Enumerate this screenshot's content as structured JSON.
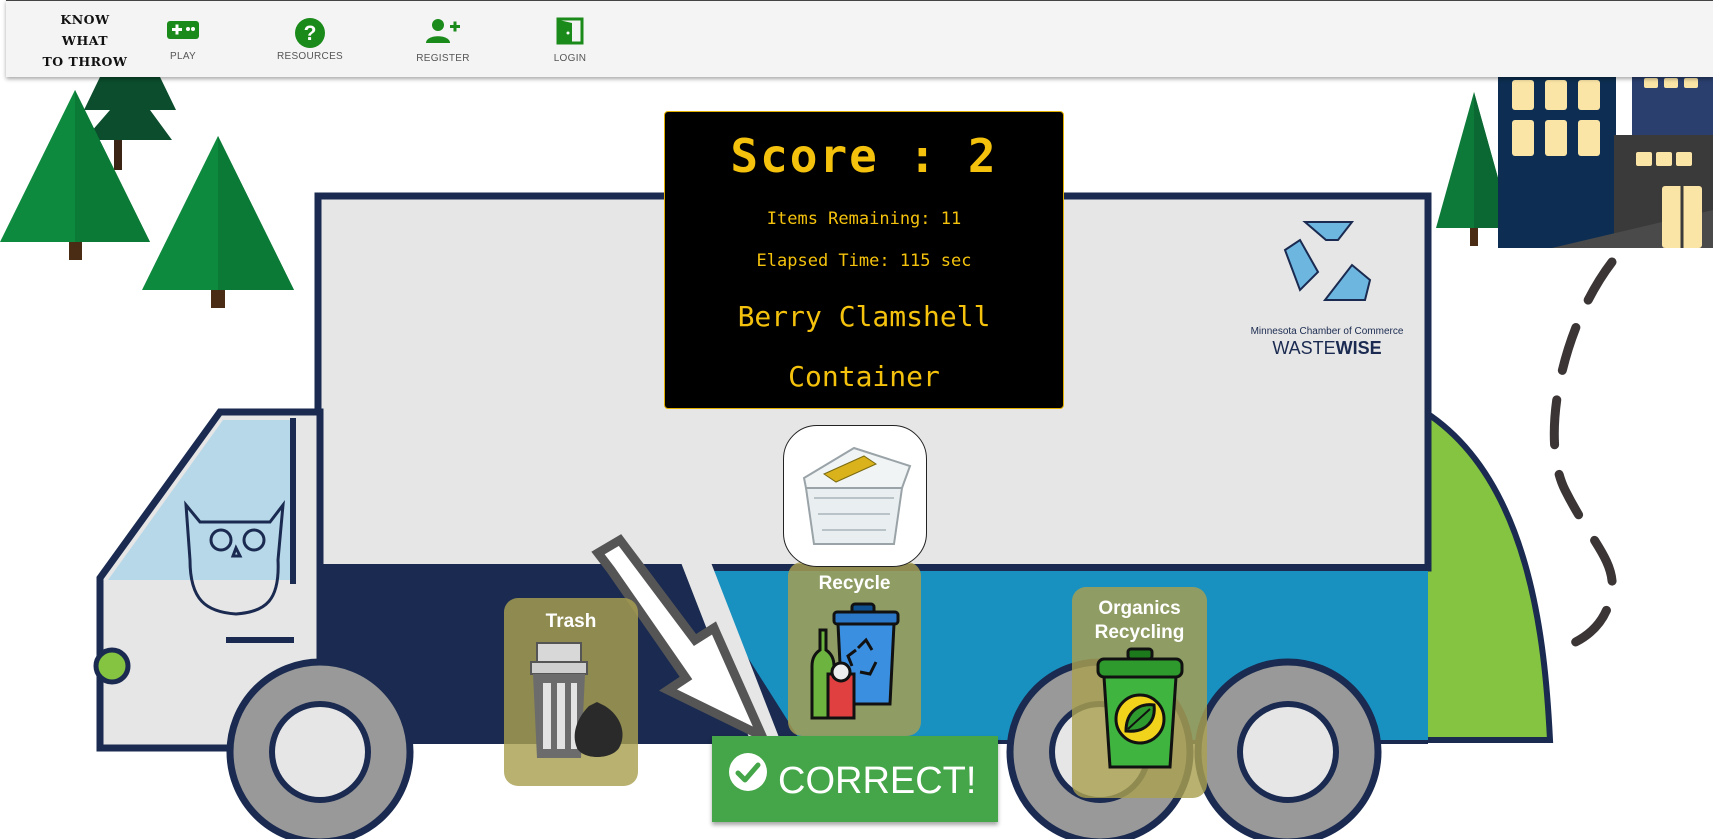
{
  "nav": {
    "logo_lines": [
      "KNOW",
      "WHAT",
      "TO THROW"
    ],
    "items": [
      {
        "label": "PLAY",
        "icon": "gamepad-icon"
      },
      {
        "label": "RESOURCES",
        "icon": "help-circle-icon"
      },
      {
        "label": "REGISTER",
        "icon": "add-user-icon"
      },
      {
        "label": "LOGIN",
        "icon": "door-icon"
      }
    ],
    "icon_color": "#1a8a1a"
  },
  "scoreboard": {
    "score_text": "Score : 2",
    "items_remaining": "Items Remaining: 11",
    "elapsed_time": "Elapsed Time: 115 sec",
    "item_name_line1": "Berry Clamshell",
    "item_name_line2": "Container",
    "text_color": "#f4c20d"
  },
  "sponsor": {
    "name_small": "Minnesota Chamber of Commerce",
    "name_light": "WASTE",
    "name_bold": "WISE"
  },
  "bins": [
    {
      "label": "Trash",
      "icon": "trash-can-icon"
    },
    {
      "label": "Recycle",
      "icon": "recycle-bin-icon"
    },
    {
      "label_line1": "Organics",
      "label_line2": "Recycling",
      "icon": "organics-bin-icon"
    }
  ],
  "feedback": {
    "text": "CORRECT!",
    "icon": "check-circle-icon",
    "color": "#45a649"
  },
  "current_item": {
    "icon": "berry-clamshell-image"
  }
}
